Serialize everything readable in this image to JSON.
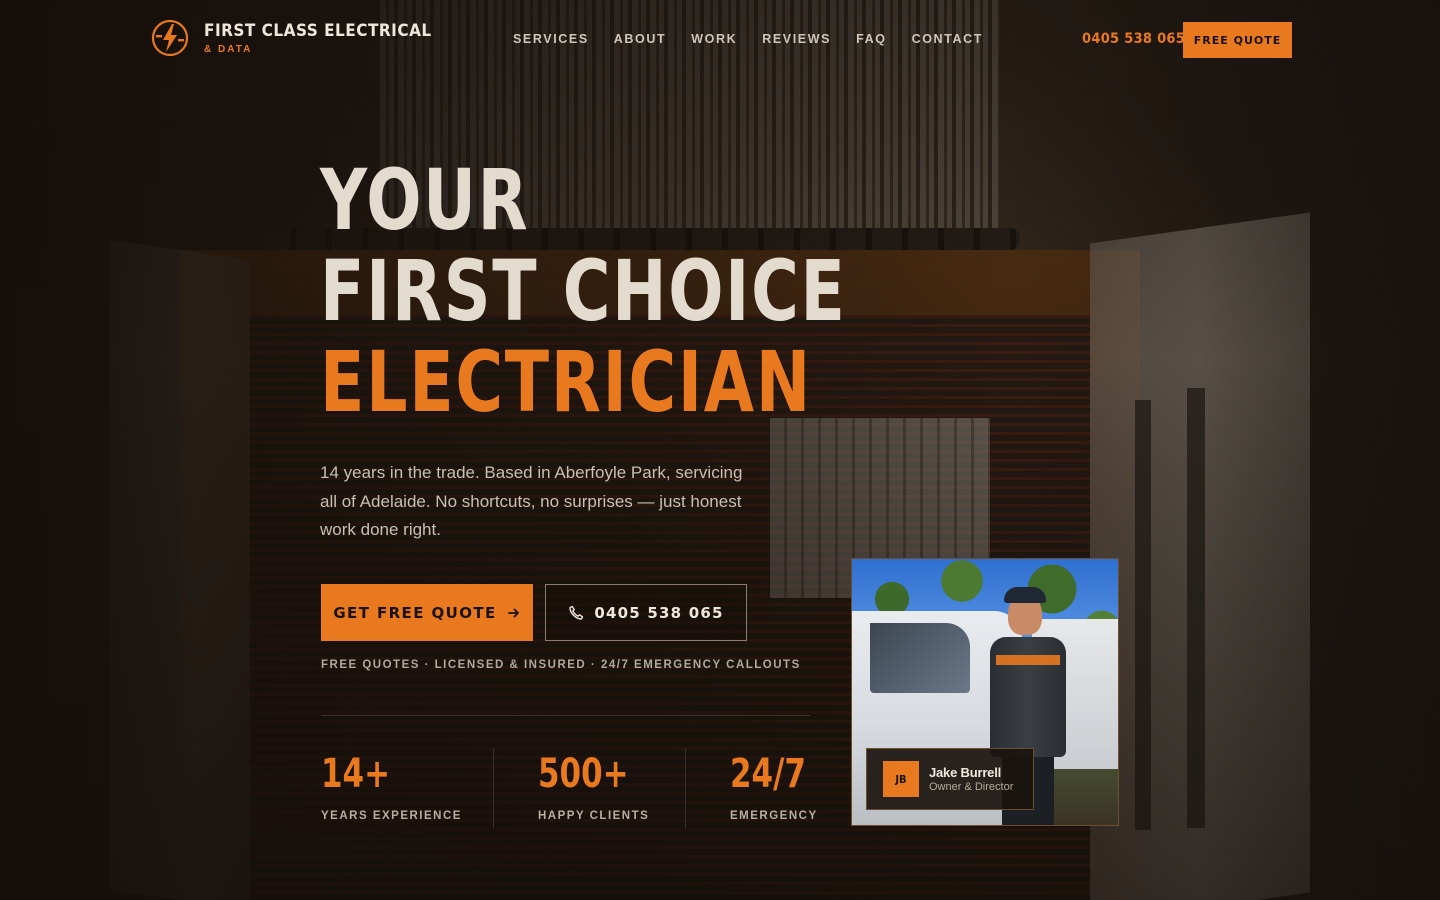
{
  "brand": {
    "name": "FIRST CLASS ELECTRICAL",
    "sub": "& DATA",
    "accent_color": "#e8791f",
    "logo_icon": "lightning-plug-icon"
  },
  "nav": {
    "items": [
      {
        "label": "SERVICES"
      },
      {
        "label": "ABOUT"
      },
      {
        "label": "WORK"
      },
      {
        "label": "REVIEWS"
      },
      {
        "label": "FAQ"
      },
      {
        "label": "CONTACT"
      }
    ]
  },
  "header": {
    "phone": "0405 538 065",
    "cta_label": "FREE QUOTE"
  },
  "hero": {
    "title_line1": "YOUR",
    "title_line2": "FIRST CHOICE",
    "title_line3": "ELECTRICIAN",
    "subtitle": "14 years in the trade. Based in Aberfoyle Park, servicing all of Adelaide. No shortcuts, no surprises — just honest work done right.",
    "primary_cta": "GET FREE QUOTE",
    "primary_cta_icon": "arrow-right-icon",
    "secondary_cta": "0405 538 065",
    "secondary_cta_icon": "phone-icon",
    "trust_line": "FREE QUOTES · LICENSED & INSURED · 24/7 EMERGENCY CALLOUTS"
  },
  "stats": [
    {
      "value": "14+",
      "label": "YEARS EXPERIENCE"
    },
    {
      "value": "500+",
      "label": "HAPPY CLIENTS"
    },
    {
      "value": "24/7",
      "label": "EMERGENCY"
    }
  ],
  "owner": {
    "initials": "JB",
    "name": "Jake Burrell",
    "role": "Owner & Director"
  }
}
